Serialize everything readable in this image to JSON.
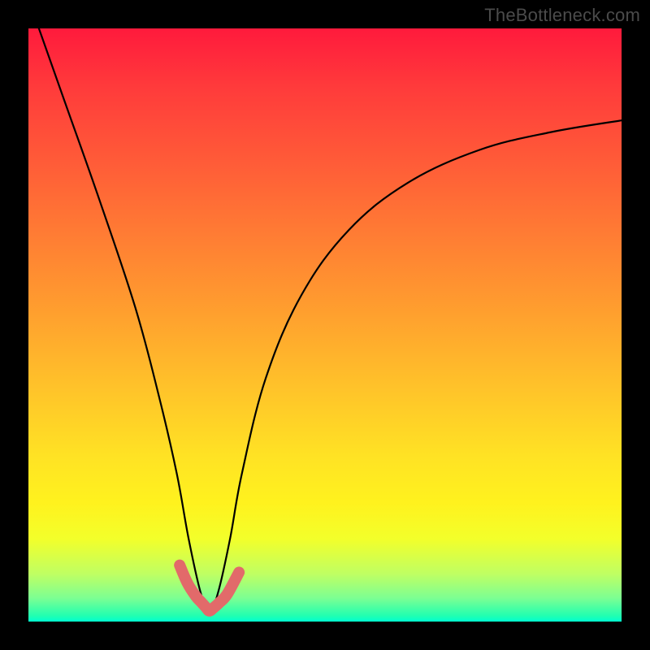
{
  "watermark": "TheBottleneck.com",
  "chart_data": {
    "type": "line",
    "title": "",
    "xlabel": "",
    "ylabel": "",
    "xlim": [
      0,
      100
    ],
    "ylim": [
      0,
      100
    ],
    "series": [
      {
        "name": "curve",
        "x": [
          0,
          6,
          12,
          18,
          22,
          25,
          27,
          29,
          30.5,
          32,
          34,
          36,
          40,
          46,
          54,
          64,
          76,
          88,
          100
        ],
        "values": [
          105,
          88,
          71,
          53,
          38,
          25,
          14,
          5,
          1.5,
          5,
          14,
          25,
          41,
          55,
          66,
          74,
          79.5,
          82.5,
          84.5
        ]
      },
      {
        "name": "bottom-highlight",
        "x": [
          25.5,
          26.8,
          28.2,
          29.2,
          30,
          30.5,
          31.2,
          32.2,
          33.5,
          35.5
        ],
        "values": [
          9.5,
          6.5,
          4.3,
          3.2,
          2.3,
          1.8,
          2.3,
          3.2,
          4.6,
          8.3
        ]
      }
    ],
    "colors": {
      "curve": "#000000",
      "bottom-highlight": "#e26a6a"
    }
  }
}
